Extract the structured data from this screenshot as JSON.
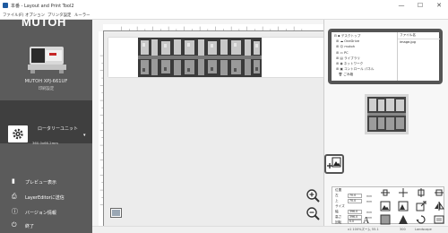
{
  "window": {
    "title": "本番 - Layout and Print Tool2",
    "controls": {
      "minimize": "—",
      "maximize": "☐",
      "close": "✕"
    }
  },
  "menu": [
    "ファイル(F)",
    "オプション",
    "プリンタ設定",
    "ルーラー"
  ],
  "sidebar": {
    "logo": "MUTOH",
    "printer_model": "MUTOH XPJ-661UF",
    "printer_status": "印刷設定",
    "unit_label": "ロータリーユニット",
    "unit_size": "360.0x66.2mm",
    "buttons": [
      {
        "icon": "preview-icon",
        "label": "プレビュー表示"
      },
      {
        "icon": "send-icon",
        "label": "LayerEditorに送信"
      },
      {
        "icon": "info-icon",
        "label": "バージョン情報"
      },
      {
        "icon": "power-icon",
        "label": "終了"
      }
    ]
  },
  "file_browser": {
    "tree": [
      "デスクトップ",
      "OneDrive",
      "mutoh",
      "PC",
      "ライブラリ",
      "ネットワーク",
      "コントロール パネル",
      "ごみ箱"
    ],
    "file_header": "ファイル名",
    "files": [
      "image.jpg"
    ]
  },
  "properties": {
    "rows": [
      {
        "label": "位置",
        "field": ""
      },
      {
        "label": "左",
        "field": "70.0",
        "unit": "mm"
      },
      {
        "label": "上",
        "field": "70.0",
        "unit": "mm"
      },
      {
        "label": "サイズ",
        "field": ""
      },
      {
        "label": "幅",
        "field": "396.0",
        "unit": "mm"
      },
      {
        "label": "高さ",
        "field": "396.0",
        "unit": "mm"
      },
      {
        "label": "回転",
        "field": "0.0",
        "unit": "°"
      }
    ]
  },
  "status": {
    "zoom": "x1 100%ズーム 55.1",
    "dpi": "300",
    "mode": "Landscape"
  },
  "colors": {
    "sidebar": "#5b5b5b",
    "highlight_border": "#555555",
    "unit_panel": "#3f3f3f"
  }
}
